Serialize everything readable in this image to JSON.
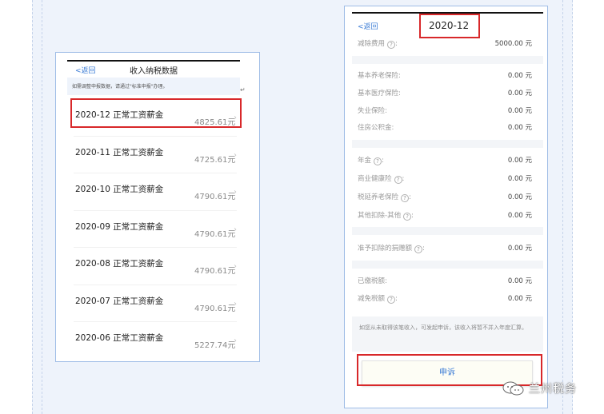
{
  "left_screen": {
    "back": "返回",
    "title": "收入纳税数据",
    "notice": "如需调整申报数据，请通过\"标准申报\"办理。",
    "rows": [
      {
        "label": "2020-12 正常工资薪金",
        "amount": "4825.61元"
      },
      {
        "label": "2020-11 正常工资薪金",
        "amount": "4725.61元"
      },
      {
        "label": "2020-10 正常工资薪金",
        "amount": "4790.61元"
      },
      {
        "label": "2020-09 正常工资薪金",
        "amount": "4790.61元"
      },
      {
        "label": "2020-08 正常工资薪金",
        "amount": "4790.61元"
      },
      {
        "label": "2020-07 正常工资薪金",
        "amount": "4790.61元"
      },
      {
        "label": "2020-06 正常工资薪金",
        "amount": "5227.74元"
      }
    ]
  },
  "right_screen": {
    "back": "返回",
    "title": "2020-12",
    "deduction": {
      "label": "减除费用",
      "value": "5000.00 元"
    },
    "insurance": [
      {
        "label": "基本养老保险:",
        "value": "0.00 元"
      },
      {
        "label": "基本医疗保险:",
        "value": "0.00 元"
      },
      {
        "label": "失业保险:",
        "value": "0.00 元"
      },
      {
        "label": "住房公积金:",
        "value": "0.00 元"
      }
    ],
    "other": [
      {
        "label": "年金",
        "value": "0.00 元"
      },
      {
        "label": "商业健康险",
        "value": "0.00 元"
      },
      {
        "label": "税延养老保险",
        "value": "0.00 元"
      },
      {
        "label": "其他扣除-其他",
        "value": "0.00 元"
      }
    ],
    "donation": {
      "label": "准予扣除的捐赠额",
      "value": "0.00 元"
    },
    "tax": [
      {
        "label": "已缴税额:",
        "value": "0.00 元"
      },
      {
        "label": "减免税额",
        "value": "0.00 元"
      }
    ],
    "note": "如您从未取得该笔收入，可发起申诉，该收入将暂不并入年度汇算。",
    "appeal_button": "申诉"
  },
  "watermark": {
    "text": "兰州税务"
  },
  "colors": {
    "highlight": "#d8282a",
    "link": "#3a7bd5",
    "panel_bg": "#eef3fb"
  }
}
